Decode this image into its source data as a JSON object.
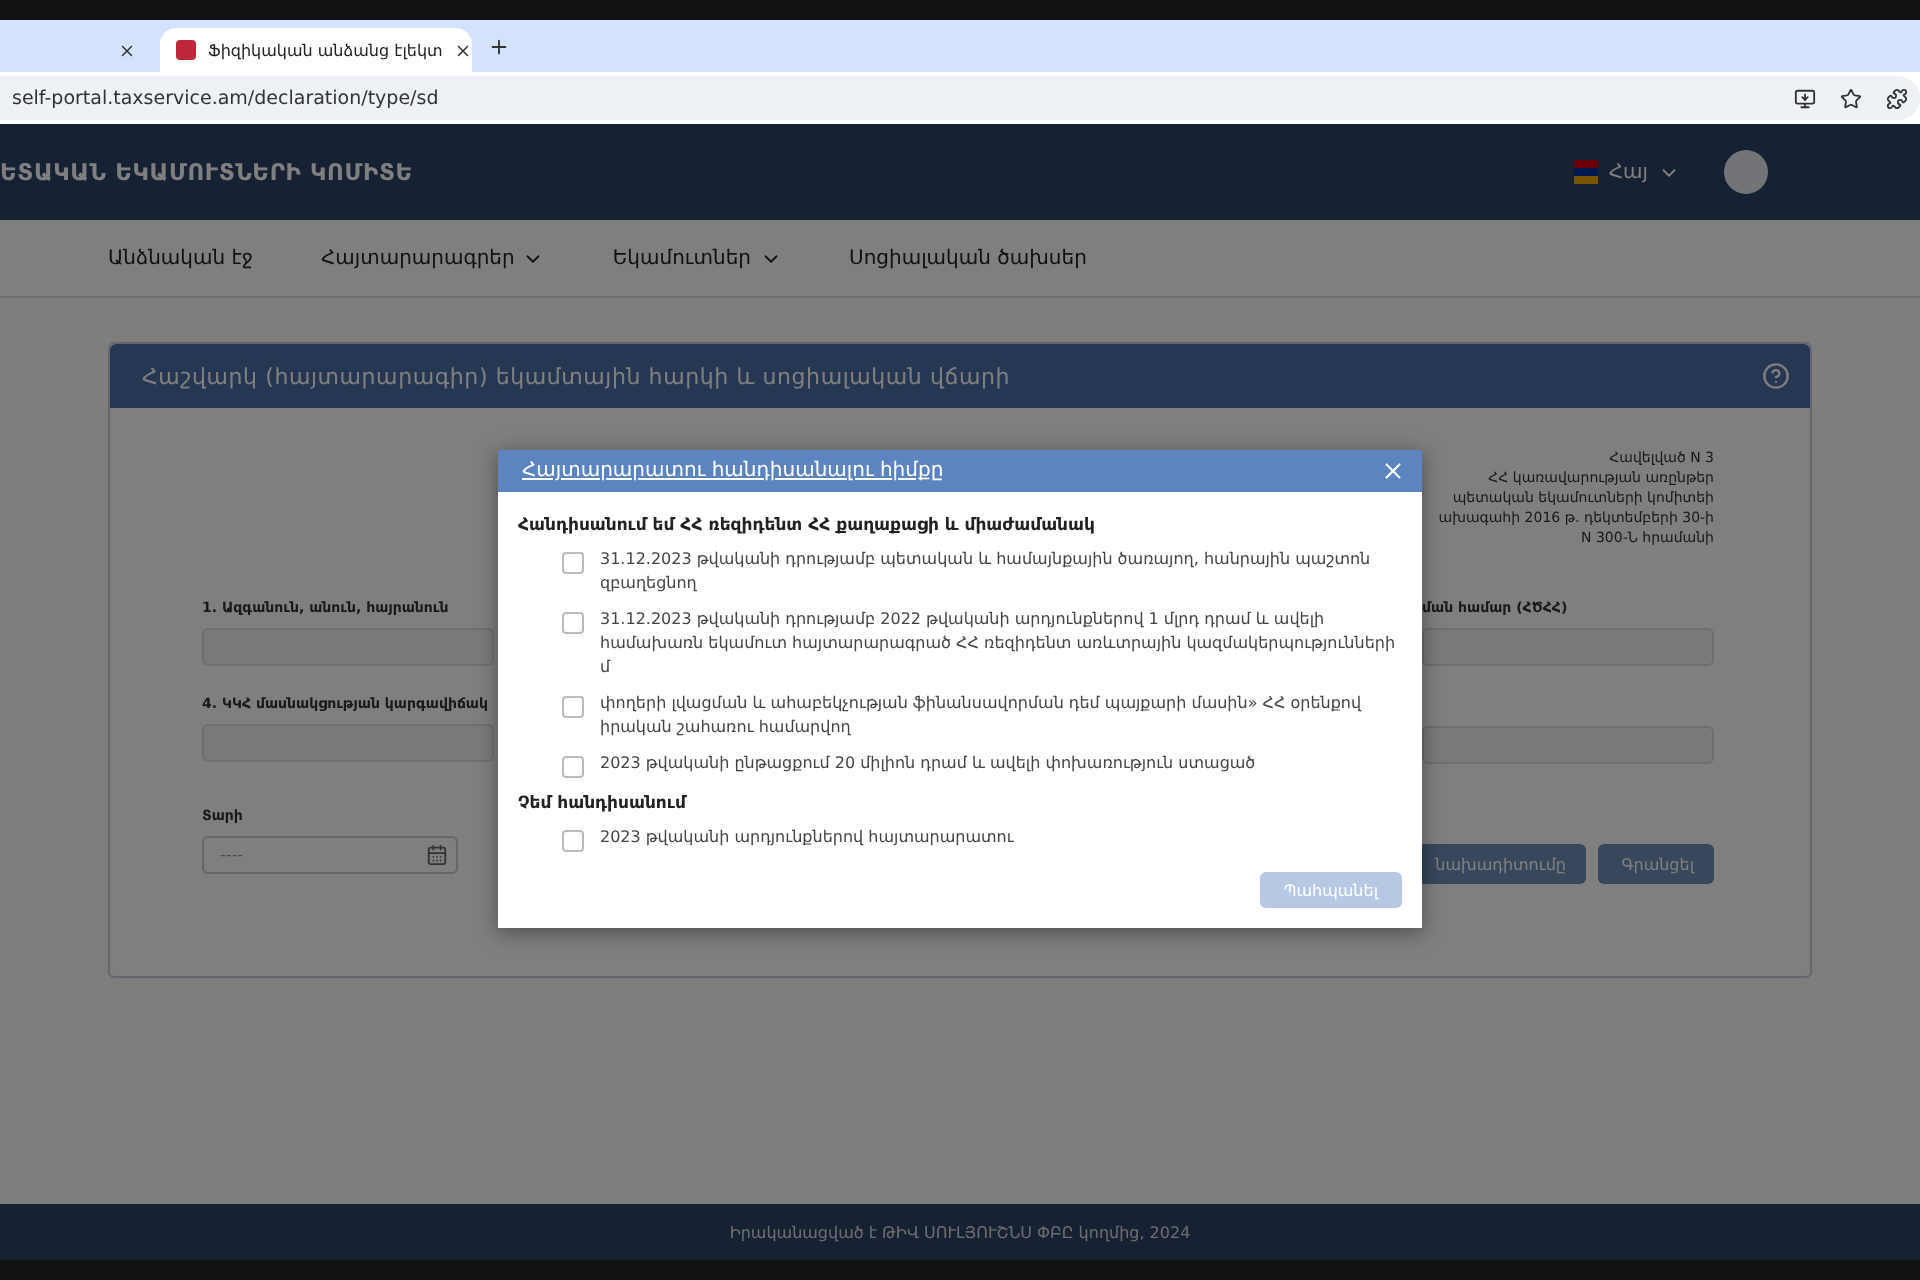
{
  "browser": {
    "tabs": [
      {
        "selected": false
      },
      {
        "title": "Ֆիզիկական անձանց էլեկտ",
        "selected": true
      }
    ],
    "url": "self-portal.taxservice.am/declaration/type/sd"
  },
  "header": {
    "title": "ԵՏԱԿԱՆ ԵԿԱՄՈՒՏՆԵՐԻ ԿՈՄԻՏԵ",
    "language": "Հայ"
  },
  "nav": [
    {
      "label": "Անձնական էջ",
      "dropdown": false
    },
    {
      "label": "Հայտարարագրեր",
      "dropdown": true
    },
    {
      "label": "Եկամուտներ",
      "dropdown": true
    },
    {
      "label": "Սոցիալական ծախսեր",
      "dropdown": false
    }
  ],
  "card": {
    "title": "Հաշվարկ (հայտարարագիր) եկամտային հարկի և սոցիալական վճարի",
    "notice": [
      "Հավելված N 3",
      "ՀՀ կառավարության առընթեր",
      "պետական եկամուտների կոմիտեի",
      "ախագահի 2016 թ. դեկտեմբերի 30-ի",
      "N 300-Ն հրամանի"
    ],
    "fields": [
      {
        "kind": "labeled",
        "label": "1. Ազգանուն, անուն, հայրանուն"
      },
      {
        "kind": "labeled",
        "label": "ման համար (ՀԾՀՀ)"
      },
      {
        "kind": "labeled",
        "label": "4. ԿԿՀ մասնակցության կարգավիճակ"
      },
      {
        "kind": "plain"
      }
    ],
    "year": {
      "label": "Տարի",
      "placeholder": "----"
    },
    "buttons": [
      "նախադիտումը",
      "Գրանցել"
    ]
  },
  "modal": {
    "title": "Հայտարարատու հանդիսանալու հիմքը",
    "groups": [
      {
        "heading": "Հանդիսանում եմ ՀՀ ռեզիդենտ ՀՀ քաղաքացի և միաժամանակ",
        "options": [
          {
            "text": "31.12.2023 թվականի դրությամբ պետական և համայնքային ծառայող, հանրային պաշտոն զբաղեցնող",
            "checked": false
          },
          {
            "text": "31.12.2023 թվականի դրությամբ 2022 թվականի արդյունքներով 1 մլրդ դրամ և ավելի համախառն եկամուտ հայտարարագրած ՀՀ ռեզիդենտ առևտրային կազմակերպությունների մ",
            "checked": false
          },
          {
            "text": "փողերի լվացման և ահաբեկչության ֆինանսավորման դեմ պայքարի մասին» ՀՀ օրենքով իրական շահառու համարվող",
            "checked": false
          },
          {
            "text": "2023 թվականի ընթացքում 20 միլիոն դրամ և ավելի փոխառություն ստացած",
            "checked": false
          }
        ]
      },
      {
        "heading": "Չեմ հանդիսանում",
        "options": [
          {
            "text": "2023 թվականի արդյունքներով հայտարարատու",
            "checked": false
          }
        ]
      }
    ],
    "button": {
      "label": "Պահպանել",
      "disabled": true
    }
  },
  "footer": "Իրականացված է ԹԻՎ ՍՈՒԼՅՈՒՇՆՍ ՓԲԸ կողմից, 2024"
}
